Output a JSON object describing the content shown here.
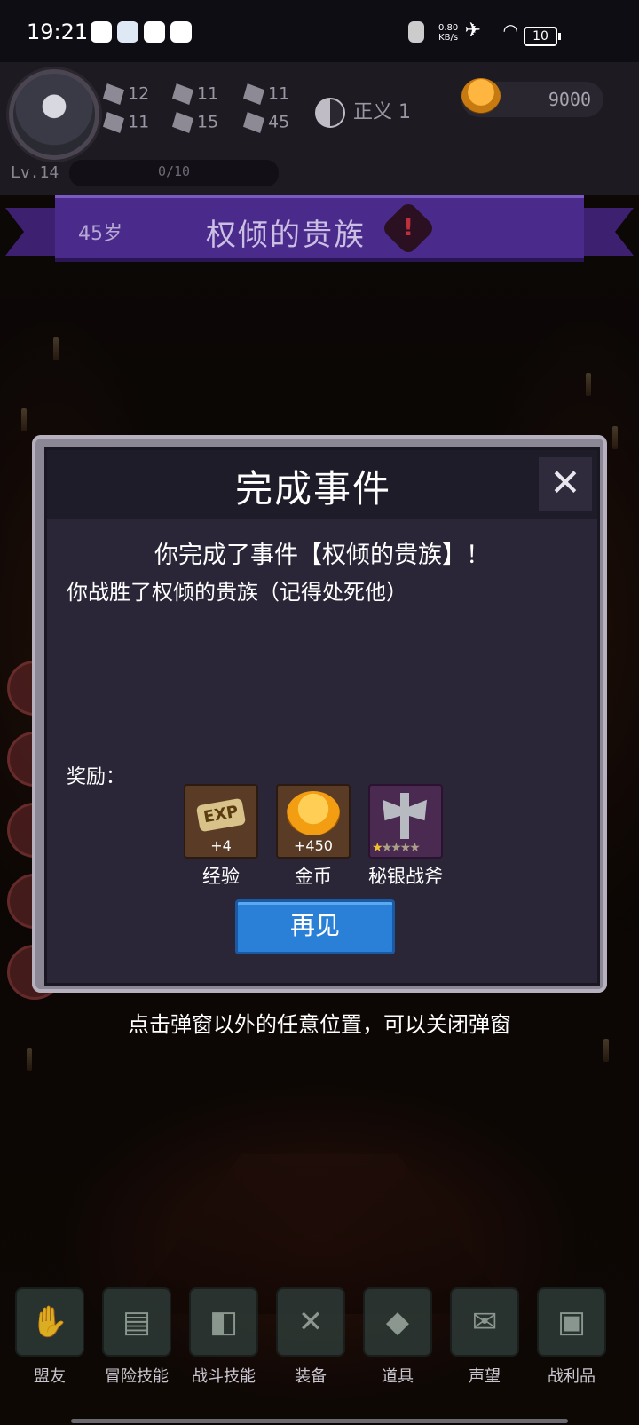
{
  "status_bar": {
    "time": "19:21",
    "net_speed_value": "0.80",
    "net_speed_unit": "KB/s",
    "battery": "10"
  },
  "hud": {
    "stats": [
      {
        "icon": "fist-icon",
        "value": "12"
      },
      {
        "icon": "sword-icon",
        "value": "11"
      },
      {
        "icon": "wizard-hat-icon",
        "value": "11"
      },
      {
        "icon": "clover-icon",
        "value": "11"
      },
      {
        "icon": "scroll-icon",
        "value": "15"
      },
      {
        "icon": "wings-icon",
        "value": "45"
      }
    ],
    "alignment_label": "正义",
    "alignment_value": "1",
    "gold": "9000",
    "level": "Lv.14",
    "xp": "0/10"
  },
  "banner": {
    "age": "45岁",
    "event_title": "权倾的贵族"
  },
  "modal": {
    "title": "完成事件",
    "close_glyph": "✕",
    "message": "你完成了事件【权倾的贵族】！",
    "description": "你战胜了权倾的贵族（记得处死他）",
    "reward_label": "奖励：",
    "rewards": [
      {
        "name": "经验",
        "amount": "+4",
        "icon": "exp-scroll-icon"
      },
      {
        "name": "金币",
        "amount": "+450",
        "icon": "gold-coin-icon"
      },
      {
        "name": "秘银战斧",
        "amount": "",
        "icon": "battle-axe-icon",
        "stars": 1,
        "max_stars": 5
      }
    ],
    "confirm_button": "再见"
  },
  "hint": "点击弹窗以外的任意位置，可以关闭弹窗",
  "bottom_nav": [
    {
      "label": "盟友",
      "icon": "handshake-icon"
    },
    {
      "label": "冒险技能",
      "icon": "spellbook-icon"
    },
    {
      "label": "战斗技能",
      "icon": "backpack-icon"
    },
    {
      "label": "装备",
      "icon": "crossed-swords-icon"
    },
    {
      "label": "道具",
      "icon": "pouch-icon"
    },
    {
      "label": "声望",
      "icon": "parchment-icon"
    },
    {
      "label": "战利品",
      "icon": "treasure-chest-icon"
    }
  ]
}
